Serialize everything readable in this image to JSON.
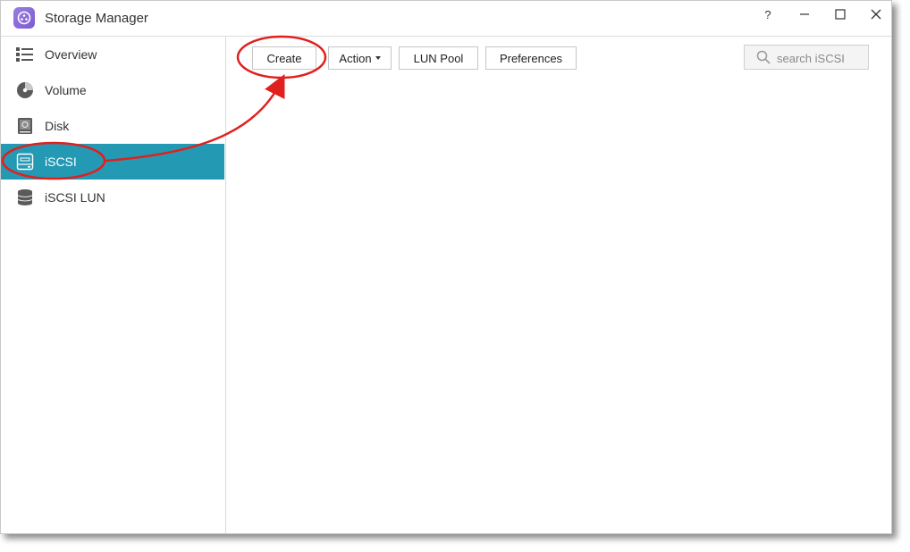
{
  "window": {
    "title": "Storage Manager"
  },
  "titlebar_buttons": [
    {
      "name": "help",
      "glyph": "?"
    },
    {
      "name": "minimize",
      "glyph": "—"
    },
    {
      "name": "maximize",
      "glyph": "☐"
    },
    {
      "name": "close",
      "glyph": "✕"
    }
  ],
  "sidebar": {
    "items": [
      {
        "label": "Overview",
        "icon": "list-icon"
      },
      {
        "label": "Volume",
        "icon": "volume-icon"
      },
      {
        "label": "Disk",
        "icon": "disk-icon"
      },
      {
        "label": "iSCSI",
        "icon": "iscsi-icon",
        "active": true
      },
      {
        "label": "iSCSI LUN",
        "icon": "database-icon"
      }
    ]
  },
  "toolbar": {
    "create_label": "Create",
    "action_label": "Action",
    "lun_pool_label": "LUN Pool",
    "preferences_label": "Preferences"
  },
  "search": {
    "placeholder": "search iSCSI"
  },
  "colors": {
    "accent": "#2499b3",
    "annotation": "#e0201e",
    "app_icon": "#8a6cd8"
  }
}
